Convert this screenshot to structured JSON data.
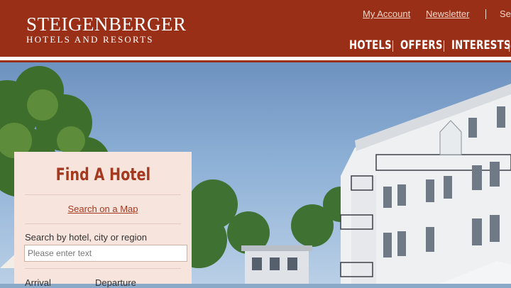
{
  "brand": {
    "name": "STEIGENBERGER",
    "tagline": "HOTELS AND RESORTS"
  },
  "top_links": {
    "account": "My Account",
    "newsletter": "Newsletter",
    "search_cut": "Se"
  },
  "main_nav": [
    "HOTELS",
    "OFFERS",
    "INTERESTS"
  ],
  "find_hotel": {
    "title": "Find A Hotel",
    "map_link": "Search on a Map",
    "search_label": "Search by hotel, city or region",
    "search_placeholder": "Please enter text",
    "search_value": "",
    "arrival_label": "Arrival",
    "departure_label": "Departure"
  },
  "colors": {
    "header_bg": "#9a2f17",
    "panel_bg": "#f7e4dc",
    "accent_text": "#a4391f"
  }
}
